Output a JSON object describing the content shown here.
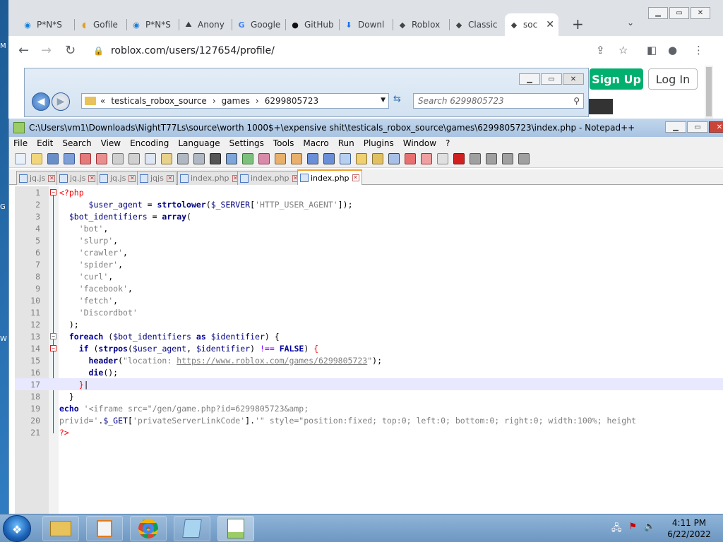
{
  "browser": {
    "tabs": [
      {
        "label": "P*N*S",
        "icon": "edge-icon"
      },
      {
        "label": "Gofile",
        "icon": "gofile-icon"
      },
      {
        "label": "P*N*S",
        "icon": "edge-icon"
      },
      {
        "label": "Anony",
        "icon": "anon-icon"
      },
      {
        "label": "Google",
        "icon": "google-icon"
      },
      {
        "label": "GitHub",
        "icon": "github-icon"
      },
      {
        "label": "Downl",
        "icon": "download-icon"
      },
      {
        "label": "Roblox",
        "icon": "roblox-icon"
      },
      {
        "label": "Classic",
        "icon": "roblox-icon"
      },
      {
        "label": "soc",
        "icon": "roblox-icon"
      }
    ],
    "url": "roblox.com/users/127654/profile/",
    "signup_label": "Sign Up",
    "login_label": "Log In"
  },
  "explorer": {
    "breadcrumbs": [
      "«",
      "testicals_robox_source",
      "›",
      "games",
      "›",
      "6299805723"
    ],
    "search_placeholder": "Search 6299805723"
  },
  "notepadpp": {
    "title": "C:\\Users\\vm1\\Downloads\\NightT77Ls\\source\\worth 1000$+\\expensive shit\\testicals_robox_source\\games\\6299805723\\index.php - Notepad++",
    "menu": [
      "File",
      "Edit",
      "Search",
      "View",
      "Encoding",
      "Language",
      "Settings",
      "Tools",
      "Macro",
      "Run",
      "Plugins",
      "Window",
      "?"
    ],
    "tabs": [
      {
        "label": "jq.js",
        "active": false
      },
      {
        "label": "jq.js",
        "active": false
      },
      {
        "label": "jq.js",
        "active": false
      },
      {
        "label": "jqjs",
        "active": false
      },
      {
        "label": "index.php",
        "active": false
      },
      {
        "label": "index.php",
        "active": false
      },
      {
        "label": "index.php",
        "active": true
      }
    ],
    "line_numbers": [
      "1",
      "2",
      "3",
      "4",
      "5",
      "6",
      "7",
      "8",
      "9",
      "10",
      "11",
      "12",
      "13",
      "14",
      "15",
      "16",
      "17",
      "18",
      "19",
      "20",
      "21"
    ]
  },
  "taskbar": {
    "time": "4:11 PM",
    "date": "6/22/2022"
  },
  "colors": {
    "signup_green": "#00b06f",
    "php_tag_red": "#ff0000",
    "keyword_blue": "#0000a0"
  }
}
